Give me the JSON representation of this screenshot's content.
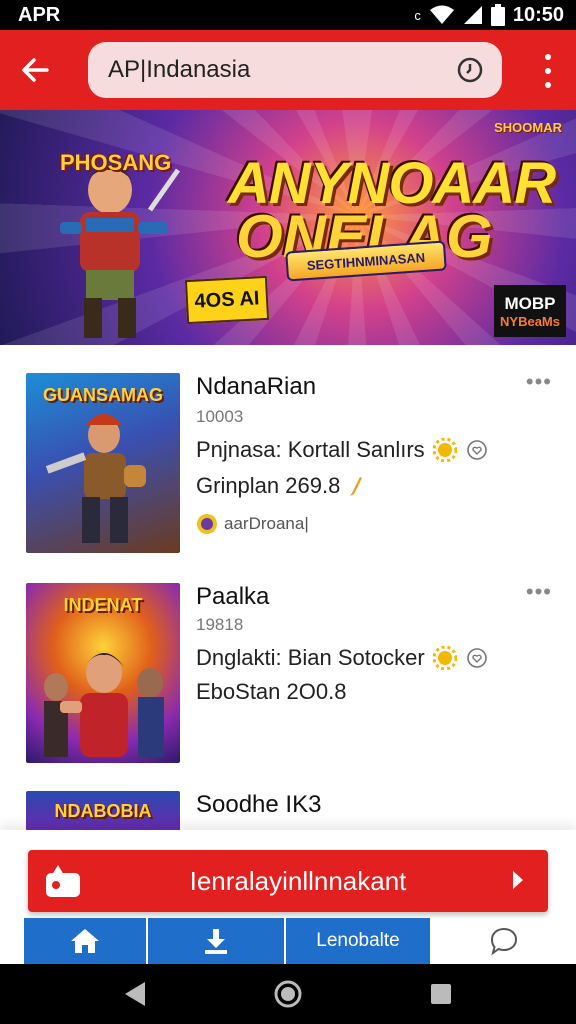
{
  "status_bar": {
    "carrier": "APR",
    "small": "c",
    "time": "10:50"
  },
  "top_bar": {
    "search_value": "AP|Indanasia"
  },
  "banner": {
    "logo": "PHOSANG",
    "title_line1": "ANYNOAAR",
    "title_line2": "ONELAG",
    "ribbon": "SEGTIHNMINASAN",
    "tag": "4OS AI",
    "badge": "SHOOMAR",
    "card_line1": "MOBP",
    "card_line2": "NYBeaMs"
  },
  "items": [
    {
      "thumb_label": "GUANSAMAG",
      "title": "NdanaRian",
      "sub": "10003",
      "line1": "Pnjnasa: Kortall Sanlırs",
      "line2": "Grinplan 269.8",
      "developer": "aarDroana|"
    },
    {
      "thumb_label": "INDENAT",
      "title": "Paalka",
      "sub": "19818",
      "line1": "Dnglakti: Bian Sotocker",
      "line2": "EboStan 2O0.8",
      "developer": ""
    },
    {
      "thumb_label": "NDABOBIA",
      "title": "Soodhe IK3",
      "sub": "",
      "line1": "",
      "line2": "",
      "developer": ""
    }
  ],
  "install_button": {
    "label": "Ienralayinllnnakant"
  },
  "tabs": [
    {
      "icon": "home-icon"
    },
    {
      "icon": "download-icon"
    },
    {
      "label": "Lenobalte"
    },
    {
      "icon": "chat-icon"
    }
  ],
  "colors": {
    "brand_red": "#e1201f",
    "tab_blue": "#1f6ec9"
  }
}
